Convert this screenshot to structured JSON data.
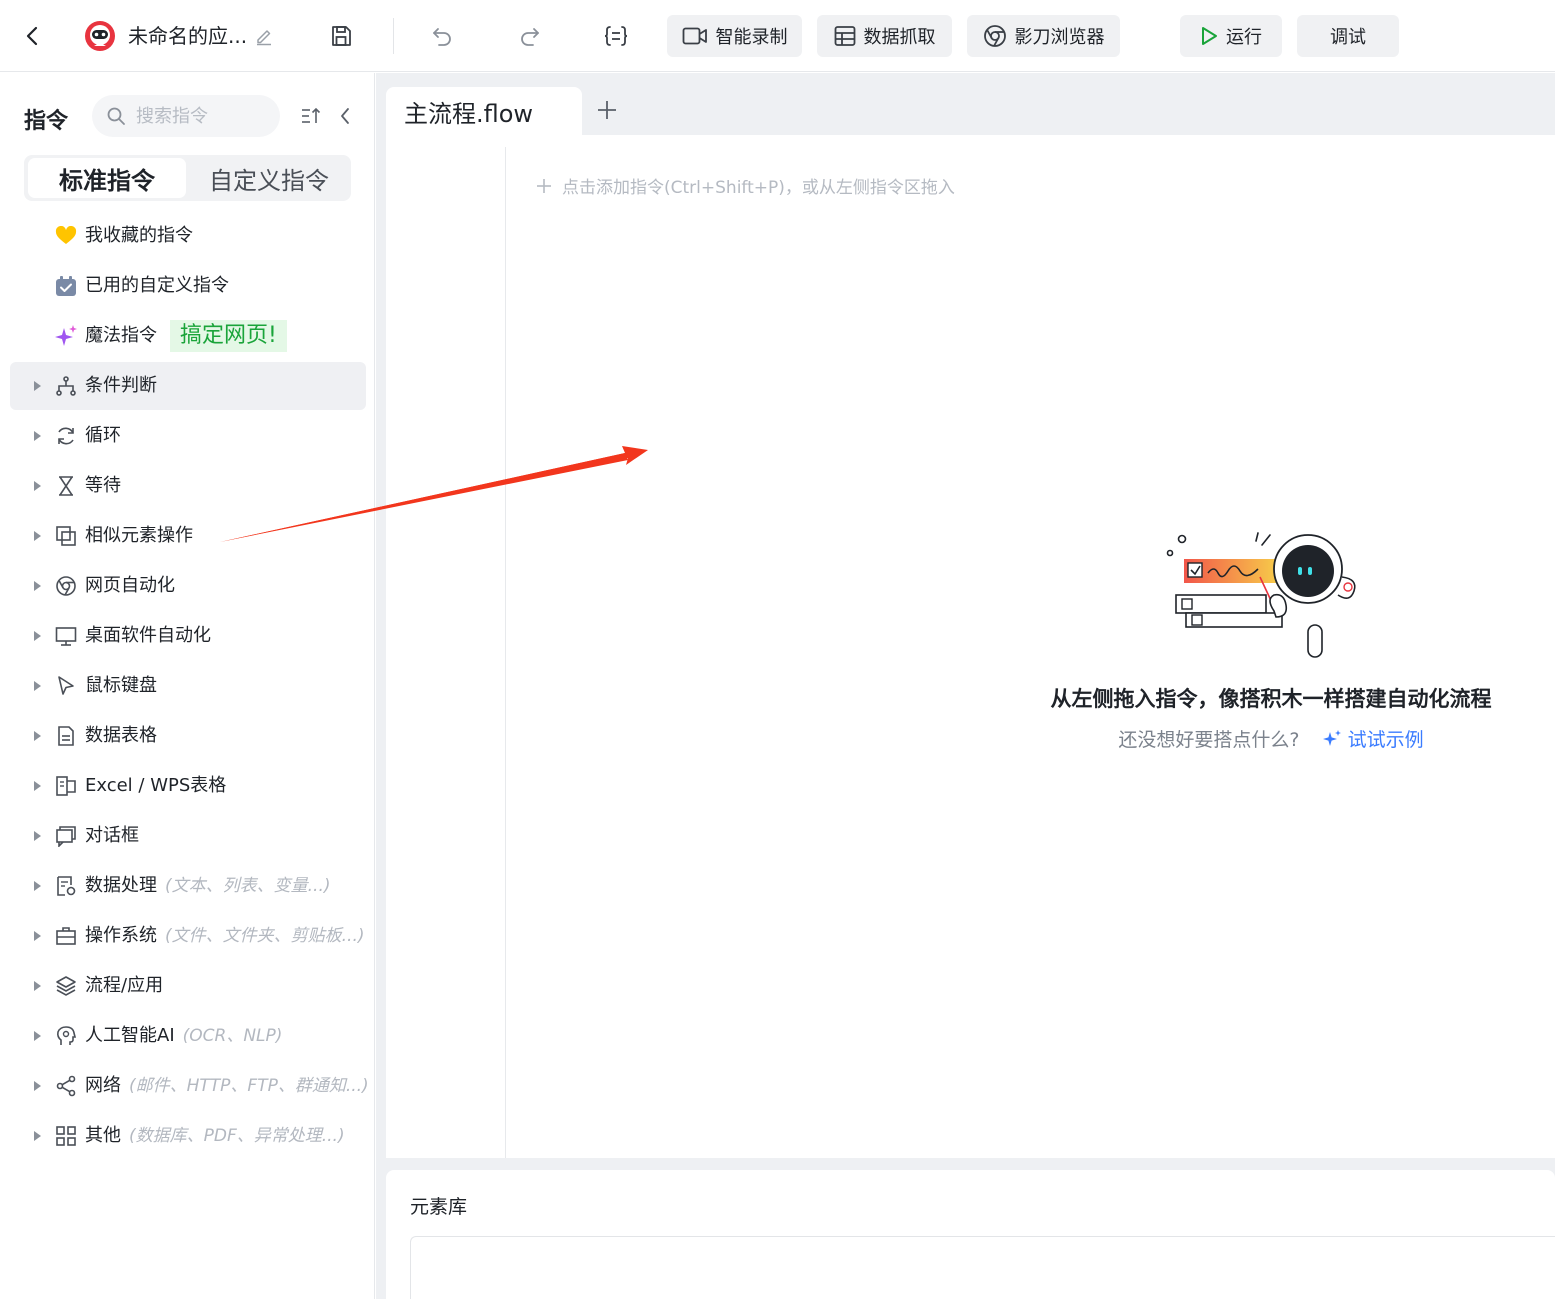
{
  "toolbar": {
    "title": "未命名的应...",
    "buttons": {
      "record": "智能录制",
      "scrape": "数据抓取",
      "browser": "影刀浏览器",
      "run": "运行",
      "debug": "调试"
    },
    "icons": [
      "back-icon",
      "app-logo",
      "edit-icon",
      "save-icon",
      "undo-icon",
      "redo-icon",
      "variables-icon"
    ]
  },
  "sidebar": {
    "title": "指令",
    "search_placeholder": "搜索指令",
    "tabs": [
      "标准指令",
      "自定义指令"
    ],
    "active_tab": "标准指令",
    "special_items": [
      {
        "label": "我收藏的指令",
        "icon": "heart-icon"
      },
      {
        "label": "已用的自定义指令",
        "icon": "custom-box-icon"
      },
      {
        "label": "魔法指令",
        "icon": "sparkle-icon",
        "tag": "搞定网页!"
      }
    ],
    "categories": [
      {
        "label": "条件判断",
        "hint": "",
        "icon": "branch-icon"
      },
      {
        "label": "循环",
        "hint": "",
        "icon": "loop-icon"
      },
      {
        "label": "等待",
        "hint": "",
        "icon": "hourglass-icon"
      },
      {
        "label": "相似元素操作",
        "hint": "",
        "icon": "similar-elements-icon"
      },
      {
        "label": "网页自动化",
        "hint": "",
        "icon": "browser-icon"
      },
      {
        "label": "桌面软件自动化",
        "hint": "",
        "icon": "monitor-icon"
      },
      {
        "label": "鼠标键盘",
        "hint": "",
        "icon": "cursor-icon"
      },
      {
        "label": "数据表格",
        "hint": "",
        "icon": "sheet-icon"
      },
      {
        "label": "Excel / WPS表格",
        "hint": "",
        "icon": "excel-icon"
      },
      {
        "label": "对话框",
        "hint": "",
        "icon": "dialog-icon"
      },
      {
        "label": "数据处理",
        "hint": "(文本、列表、变量...)",
        "icon": "data-process-icon"
      },
      {
        "label": "操作系统",
        "hint": "(文件、文件夹、剪贴板...)",
        "icon": "os-icon"
      },
      {
        "label": "流程/应用",
        "hint": "",
        "icon": "layers-icon"
      },
      {
        "label": "人工智能AI",
        "hint": "(OCR、NLP)",
        "icon": "ai-icon"
      },
      {
        "label": "网络",
        "hint": "(邮件、HTTP、FTP、群通知...)",
        "icon": "share-icon"
      },
      {
        "label": "其他",
        "hint": "(数据库、PDF、异常处理...)",
        "icon": "grid-icon"
      }
    ],
    "highlighted_category": "条件判断"
  },
  "editor": {
    "tab_label": "主流程.flow",
    "canvas_hint": "点击添加指令(Ctrl+Shift+P)，或从左侧指令区拖入",
    "empty_title": "从左侧拖入指令，像搭积木一样搭建自动化流程",
    "empty_question": "还没想好要搭点什么?",
    "try_example": "试试示例"
  },
  "element_library": {
    "title": "元素库"
  },
  "colors": {
    "accent_blue": "#3b7cff",
    "run_green": "#1aa43a",
    "annotation_arrow": "#f2361d",
    "magic_tag_bg": "#e4f8e6"
  }
}
